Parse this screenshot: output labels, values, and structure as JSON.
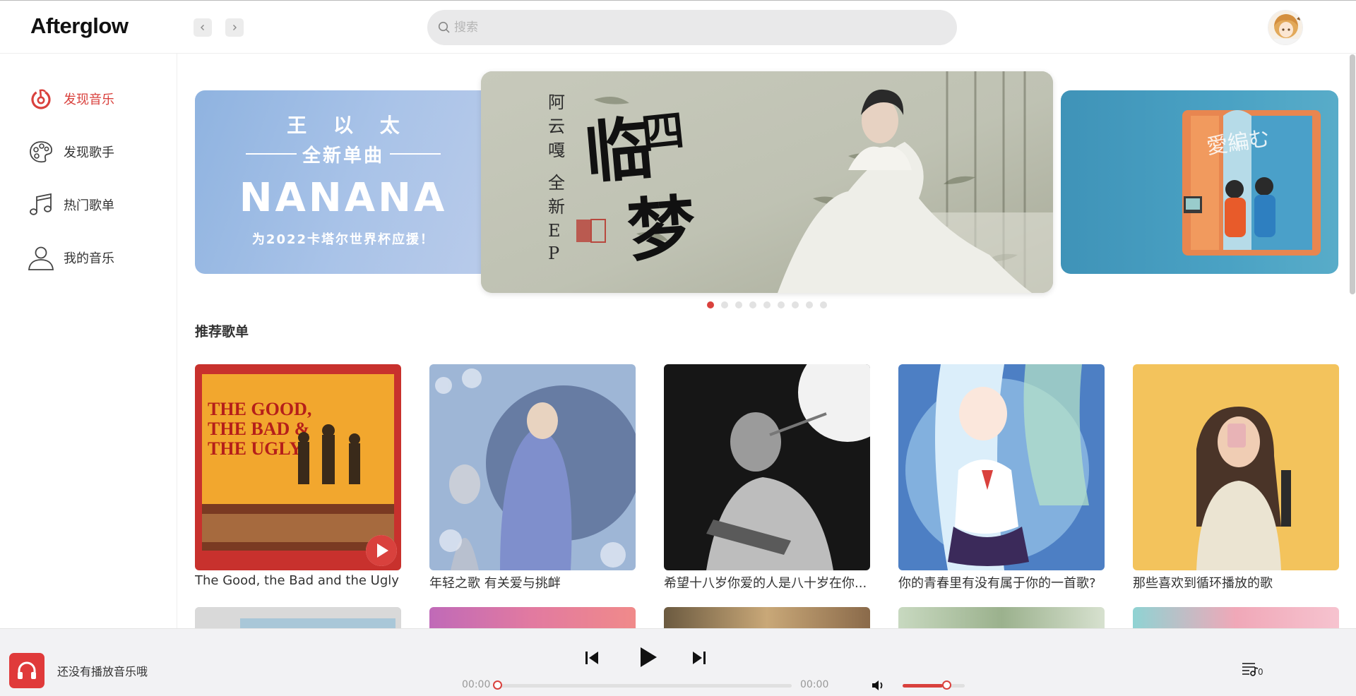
{
  "app": {
    "title": "Afterglow"
  },
  "search": {
    "placeholder": "搜索",
    "value": ""
  },
  "sidebar": {
    "items": [
      {
        "label": "发现音乐",
        "icon": "netease-music-icon",
        "active": true
      },
      {
        "label": "发现歌手",
        "icon": "palette-icon",
        "active": false
      },
      {
        "label": "热门歌单",
        "icon": "music-note-icon",
        "active": false
      },
      {
        "label": "我的音乐",
        "icon": "user-icon",
        "active": false
      }
    ]
  },
  "banners": {
    "left": {
      "artist": "王 以 太",
      "subtitle": "全新单曲",
      "title": "NANANA",
      "footer": "为2022卡塔尔世界杯应援！"
    },
    "center": {
      "artist_vertical": "阿云嘎",
      "release_vertical": "全新EP",
      "title_vertical": "临四梦"
    },
    "right": {
      "title": "愛編む"
    },
    "dots": 9,
    "active_dot": 0
  },
  "recommend": {
    "title": "推荐歌单",
    "playlists": [
      {
        "name": "The Good, the Bad and the Ugly"
      },
      {
        "name": "年轻之歌 有关爱与挑衅"
      },
      {
        "name": "希望十八岁你爱的人是八十岁在你..."
      },
      {
        "name": "你的青春里有没有属于你的一首歌?"
      },
      {
        "name": "那些喜欢到循环播放的歌"
      }
    ]
  },
  "player": {
    "status_text": "还没有播放音乐哦",
    "current_time": "00:00",
    "total_time": "00:00",
    "progress": 0,
    "volume": 0.65,
    "queue_count": "0"
  },
  "colors": {
    "accent": "#d9413d"
  }
}
